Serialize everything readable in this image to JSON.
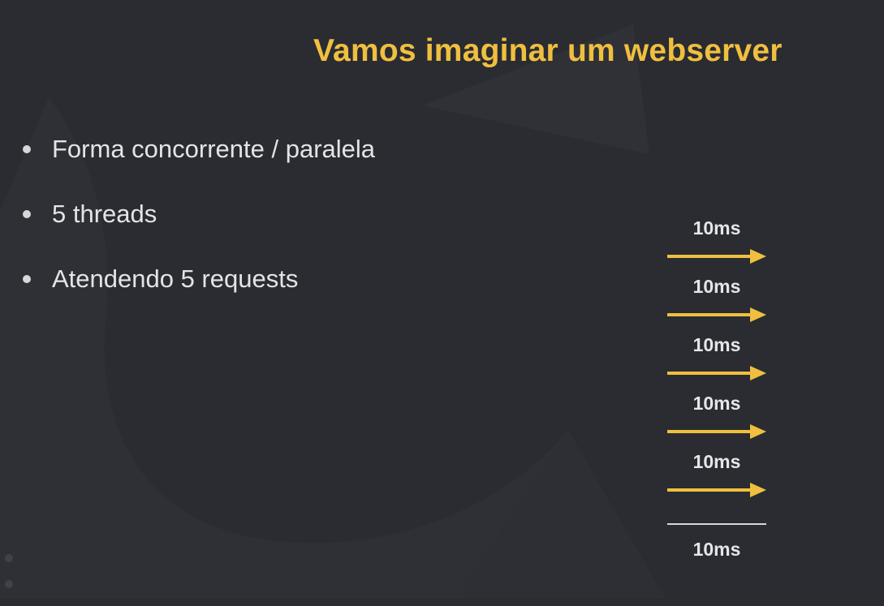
{
  "slide": {
    "title": "Vamos imaginar um webserver",
    "bullets": [
      "Forma concorrente / paralela",
      "5 threads",
      "Atendendo 5 requests"
    ]
  },
  "diagram": {
    "requests": [
      {
        "label": "10ms"
      },
      {
        "label": "10ms"
      },
      {
        "label": "10ms"
      },
      {
        "label": "10ms"
      },
      {
        "label": "10ms"
      }
    ],
    "total_label": "10ms"
  },
  "colors": {
    "background": "#2a2c32",
    "title": "#f0bf3f",
    "arrow": "#f0bf3f",
    "text": "#e4e4e6"
  },
  "page_indicator": {
    "count": 2
  }
}
